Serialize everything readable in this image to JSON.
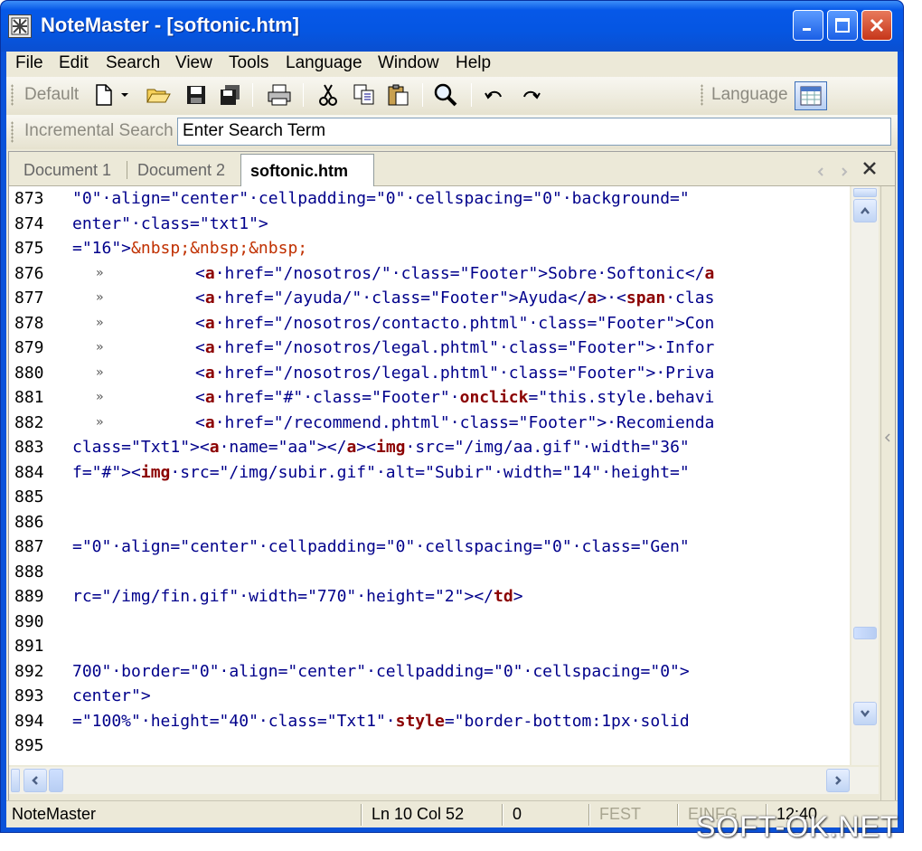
{
  "window": {
    "title": "NoteMaster - [softonic.htm]"
  },
  "menubar": [
    "File",
    "Edit",
    "Search",
    "View",
    "Tools",
    "Language",
    "Window",
    "Help"
  ],
  "toolbar": {
    "default_label": "Default",
    "language_label": "Language"
  },
  "search": {
    "label": "Incremental Search",
    "value": "Enter Search Term"
  },
  "tabs": [
    "Document 1",
    "Document 2",
    "softonic.htm"
  ],
  "status": {
    "app": "NoteMaster",
    "position": "Ln 10 Col 52",
    "count": "0",
    "fest": "FEST",
    "einfg": "EINFG",
    "time": "12:40"
  },
  "watermark": "SOFT-OK.NET",
  "lines": [
    {
      "n": "873",
      "text": "\"0\"·align=\"center\"·cellpadding=\"0\"·cellspacing=\"0\"·background=\""
    },
    {
      "n": "874",
      "text": "enter\"·class=\"txt1\">"
    },
    {
      "n": "875",
      "text": "=\"16\">&nbsp;&nbsp;&nbsp;"
    },
    {
      "n": "876",
      "text": "<a·href=\"/nosotros/\"·class=\"Footer\">Sobre·Softonic</a",
      "arrow": true
    },
    {
      "n": "877",
      "text": "<a·href=\"/ayuda/\"·class=\"Footer\">Ayuda</a>·<span·clas",
      "arrow": true
    },
    {
      "n": "878",
      "text": "<a·href=\"/nosotros/contacto.phtml\"·class=\"Footer\">Con",
      "arrow": true
    },
    {
      "n": "879",
      "text": "<a·href=\"/nosotros/legal.phtml\"·class=\"Footer\">·Infor",
      "arrow": true
    },
    {
      "n": "880",
      "text": "<a·href=\"/nosotros/legal.phtml\"·class=\"Footer\">·Priva",
      "arrow": true
    },
    {
      "n": "881",
      "text": "<a·href=\"#\"·class=\"Footer\"·onclick=\"this.style.behavi",
      "arrow": true
    },
    {
      "n": "882",
      "text": "<a·href=\"/recommend.phtml\"·class=\"Footer\">·Recomienda",
      "arrow": true
    },
    {
      "n": "883",
      "text": "class=\"Txt1\"><a·name=\"aa\"></a><img·src=\"/img/aa.gif\"·width=\"36\""
    },
    {
      "n": "884",
      "text": "f=\"#\"><img·src=\"/img/subir.gif\"·alt=\"Subir\"·width=\"14\"·height=\""
    },
    {
      "n": "885",
      "text": ""
    },
    {
      "n": "886",
      "text": ""
    },
    {
      "n": "887",
      "text": "=\"0\"·align=\"center\"·cellpadding=\"0\"·cellspacing=\"0\"·class=\"Gen\""
    },
    {
      "n": "888",
      "text": ""
    },
    {
      "n": "889",
      "text": "rc=\"/img/fin.gif\"·width=\"770\"·height=\"2\"></td>"
    },
    {
      "n": "890",
      "text": ""
    },
    {
      "n": "891",
      "text": ""
    },
    {
      "n": "892",
      "text": "700\"·border=\"0\"·align=\"center\"·cellpadding=\"0\"·cellspacing=\"0\">"
    },
    {
      "n": "893",
      "text": "center\">"
    },
    {
      "n": "894",
      "text": "=\"100%\"·height=\"40\"·class=\"Txt1\"·style=\"border-bottom:1px·solid"
    },
    {
      "n": "895",
      "text": ""
    }
  ]
}
